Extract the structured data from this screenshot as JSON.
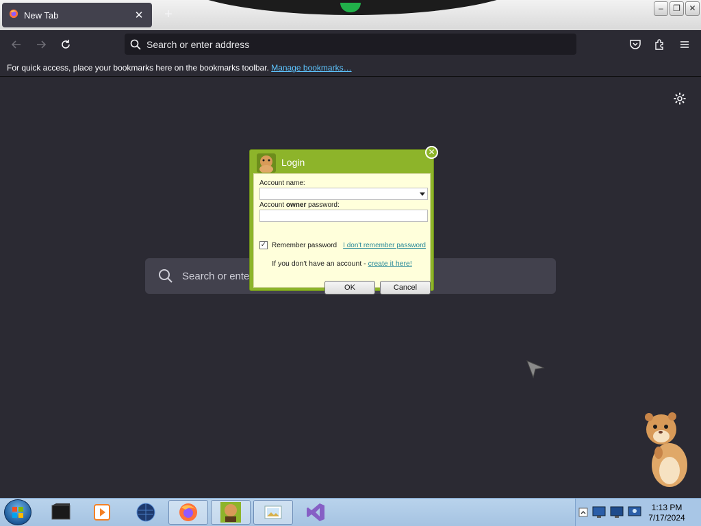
{
  "browser": {
    "tab": {
      "title": "New Tab"
    },
    "url_placeholder": "Search or enter address",
    "bookmarks_text": "For quick access, place your bookmarks here on the bookmarks toolbar.",
    "bookmarks_link": "Manage bookmarks…"
  },
  "newtab": {
    "search_placeholder": "Search or enter address"
  },
  "login_dialog": {
    "title": "Login",
    "account_label": "Account name:",
    "password_label_prefix": "Account ",
    "password_label_bold": "owner",
    "password_label_suffix": " password:",
    "account_value": "",
    "password_value": "",
    "remember_label": "Remember password",
    "remember_checked": true,
    "forgot_link": "I don't remember password",
    "no_account_text": "If you don't have an account - ",
    "create_link": "create it here!",
    "ok_label": "OK",
    "cancel_label": "Cancel",
    "accent_color": "#8db42a"
  },
  "taskbar": {
    "time": "1:13 PM",
    "date": "7/17/2024",
    "apps": [
      "terminal-icon",
      "media-player-icon",
      "globe-icon",
      "firefox-icon",
      "box-app-icon",
      "photo-viewer-icon",
      "visual-studio-icon"
    ]
  }
}
